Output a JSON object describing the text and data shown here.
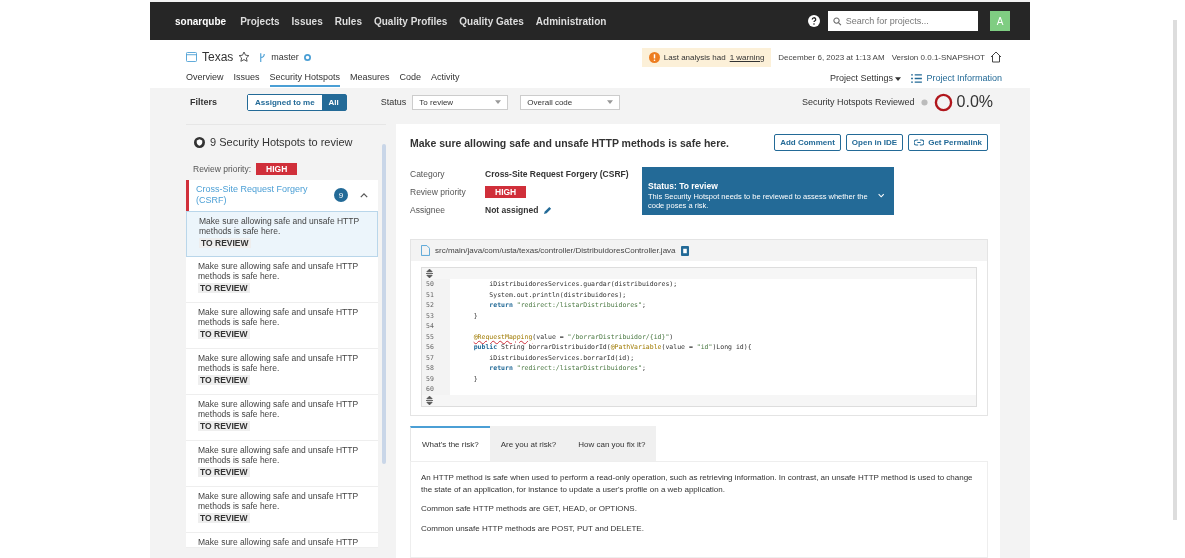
{
  "navbar": {
    "logo": "sonarqube",
    "links": [
      {
        "label": "Projects"
      },
      {
        "label": "Issues"
      },
      {
        "label": "Rules"
      },
      {
        "label": "Quality Profiles"
      },
      {
        "label": "Quality Gates"
      },
      {
        "label": "Administration"
      }
    ],
    "search": {
      "placeholder": "Search for projects..."
    },
    "avatar": "A"
  },
  "project": {
    "name": "Texas",
    "branch": "master",
    "warning_text": "Last analysis had",
    "warning_link": "1 warning",
    "date": "December 6, 2023 at 1:13 AM",
    "version": "Version 0.0.1-SNAPSHOT",
    "tabs": [
      {
        "label": "Overview",
        "selected": false
      },
      {
        "label": "Issues",
        "selected": false
      },
      {
        "label": "Security Hotspots",
        "selected": true
      },
      {
        "label": "Measures",
        "selected": false
      },
      {
        "label": "Code",
        "selected": false
      },
      {
        "label": "Activity",
        "selected": false
      }
    ],
    "settings": "Project Settings",
    "information": "Project Information"
  },
  "filters": {
    "label": "Filters",
    "toggle": [
      {
        "label": "Assigned to me",
        "selected": false
      },
      {
        "label": "All",
        "selected": true
      }
    ],
    "status_label": "Status",
    "status": "To review",
    "scope": "Overall code",
    "reviewed_label": "Security Hotspots Reviewed",
    "reviewed_value": "0.0%"
  },
  "sidebar": {
    "title": "9 Security Hotspots to review",
    "priority_label": "Review priority:",
    "priority": "HIGH",
    "category": "Cross-Site Request Forgery (CSRF)",
    "count": "9",
    "expanded": true,
    "items": [
      {
        "text": "Make sure allowing safe and unsafe HTTP methods is safe here.",
        "status": "TO REVIEW",
        "selected": true
      },
      {
        "text": "Make sure allowing safe and unsafe HTTP methods is safe here.",
        "status": "TO REVIEW",
        "selected": false
      },
      {
        "text": "Make sure allowing safe and unsafe HTTP methods is safe here.",
        "status": "TO REVIEW",
        "selected": false
      },
      {
        "text": "Make sure allowing safe and unsafe HTTP methods is safe here.",
        "status": "TO REVIEW",
        "selected": false
      },
      {
        "text": "Make sure allowing safe and unsafe HTTP methods is safe here.",
        "status": "TO REVIEW",
        "selected": false
      },
      {
        "text": "Make sure allowing safe and unsafe HTTP methods is safe here.",
        "status": "TO REVIEW",
        "selected": false
      },
      {
        "text": "Make sure allowing safe and unsafe HTTP methods is safe here.",
        "status": "TO REVIEW",
        "selected": false
      },
      {
        "text": "Make sure allowing safe and unsafe HTTP"
      }
    ]
  },
  "hotspot": {
    "title": "Make sure allowing safe and unsafe HTTP methods is safe here.",
    "buttons": [
      "Add Comment",
      "Open in IDE",
      "Get Permalink"
    ],
    "details": [
      {
        "label": "Category",
        "value": "Cross-Site Request Forgery (CSRF)",
        "kind": "text"
      },
      {
        "label": "Review priority",
        "value": "HIGH",
        "kind": "badge"
      },
      {
        "label": "Assignee",
        "value": "Not assigned",
        "kind": "editable"
      }
    ],
    "status": {
      "title": "Status: To review",
      "description": "This Security Hotspot needs to be reviewed to assess whether the code poses a risk."
    },
    "file": "src/main/java/com/usta/texas/controller/DistribuidoresController.java",
    "code": [
      {
        "n": "50",
        "parts": [
          {
            "t": "        iDistribuidoresServices.guardar(distribuidores);",
            "kind": "plain"
          }
        ]
      },
      {
        "n": "51",
        "parts": [
          {
            "t": "        System.out.println(distribuidores);",
            "kind": "plain"
          }
        ]
      },
      {
        "n": "52",
        "parts": [
          {
            "t": "        return",
            "kind": "keyword"
          },
          {
            "t": " \"redirect:/listarDistribuidores\"",
            "kind": "string"
          },
          {
            "t": ";",
            "kind": "plain"
          }
        ]
      },
      {
        "n": "53",
        "parts": [
          {
            "t": "    }",
            "kind": "plain"
          }
        ]
      },
      {
        "n": "54"
      },
      {
        "n": "55",
        "parts": [
          {
            "t": "    @RequestMapping",
            "kind": "flagged"
          },
          {
            "t": "(value = ",
            "kind": "plain"
          },
          {
            "t": "\"/borrarDistribuidor/{id}\"",
            "kind": "string"
          },
          {
            "t": ")",
            "kind": "plain"
          }
        ]
      },
      {
        "n": "56",
        "parts": [
          {
            "t": "    public",
            "kind": "keyword"
          },
          {
            "t": " String borrarDistribuidorId(",
            "kind": "plain"
          },
          {
            "t": "@PathVariable",
            "kind": "annotation"
          },
          {
            "t": "(value = ",
            "kind": "plain"
          },
          {
            "t": "\"id\"",
            "kind": "string"
          },
          {
            "t": ")Long id){",
            "kind": "plain"
          }
        ]
      },
      {
        "n": "57",
        "parts": [
          {
            "t": "        iDistribuidoresServices.borrarId(id);",
            "kind": "plain"
          }
        ]
      },
      {
        "n": "58",
        "parts": [
          {
            "t": "        return",
            "kind": "keyword"
          },
          {
            "t": " \"redirect:/listarDistribuidores\"",
            "kind": "string"
          },
          {
            "t": ";",
            "kind": "plain"
          }
        ]
      },
      {
        "n": "59",
        "parts": [
          {
            "t": "    }",
            "kind": "plain"
          }
        ]
      },
      {
        "n": "60"
      }
    ],
    "tabs": [
      {
        "label": "What's the risk?",
        "selected": true
      },
      {
        "label": "Are you at risk?",
        "selected": false
      },
      {
        "label": "How can you fix it?",
        "selected": false
      }
    ],
    "paragraphs": [
      "An HTTP method is safe when used to perform a read-only operation, such as retrieving information. In contrast, an unsafe HTTP method is used to change the state of an application, for instance to update a user's profile on a web application.",
      "Common safe HTTP methods are GET, HEAD, or OPTIONS.",
      "Common unsafe HTTP methods are POST, PUT and DELETE."
    ]
  }
}
